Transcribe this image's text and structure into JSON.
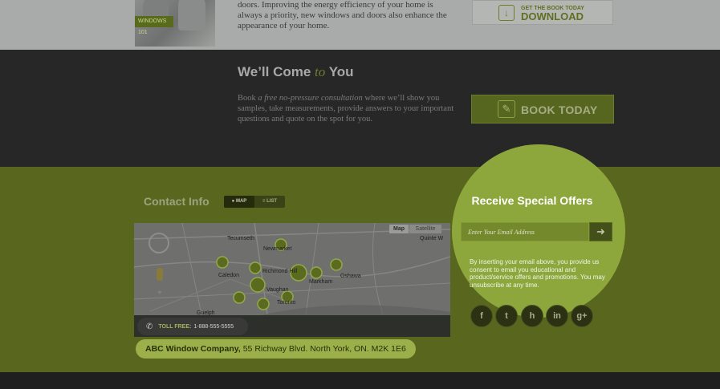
{
  "top": {
    "photo_badge": "WINDOWS 101",
    "text": "doors. Improving the energy efficiency of your home is always a priority, new windows and doors also enhance the appearance of your home.",
    "download": {
      "small": "GET THE BOOK TODAY",
      "big": "DOWNLOAD",
      "icon": "download-icon"
    }
  },
  "come": {
    "title_start": "We’ll Come ",
    "title_to": "to",
    "title_end": " You",
    "text_before": "Book ",
    "text_italic": "a free no-pressure consultation",
    "text_after": " where we’ll show you samples, take measurements, provide answers to your important questions and quote on the spot for you.",
    "book_label": "BOOK TODAY",
    "book_icon": "pencil-icon"
  },
  "contact": {
    "title": "Contact Info",
    "toggle_map": "MAP",
    "toggle_list": "LIST",
    "map_tab": "Map",
    "satellite_tab": "Satellite",
    "map_labels": [
      "Newmarket",
      "Tecumseth",
      "Caledon",
      "Richmond Hill",
      "Markham",
      "Vaughan",
      "Toronto",
      "Oshawa",
      "Quinte W",
      "Guelph"
    ],
    "toll_label": "TOLL FREE:",
    "toll_number": "1-888-555-5555",
    "company": "ABC Window Company,",
    "address": "55 Richway Blvd. North York, ON. M2K 1E6"
  },
  "offers": {
    "title": "Receive Special Offers",
    "email_placeholder": "Enter Your Email Address",
    "submit_icon": "arrow-right-icon",
    "consent": "By inserting your email above, you provide us consent to email you educational and product/service offers and promotions. You may unsubscribe at any time."
  },
  "social": [
    {
      "name": "facebook",
      "glyph": "f"
    },
    {
      "name": "twitter",
      "glyph": "t"
    },
    {
      "name": "houzz",
      "glyph": "h"
    },
    {
      "name": "linkedin",
      "glyph": "in"
    },
    {
      "name": "google-plus",
      "glyph": "g+"
    }
  ],
  "colors": {
    "accent_green": "#8da73d",
    "band_green": "#58661e",
    "dark": "#272727"
  }
}
